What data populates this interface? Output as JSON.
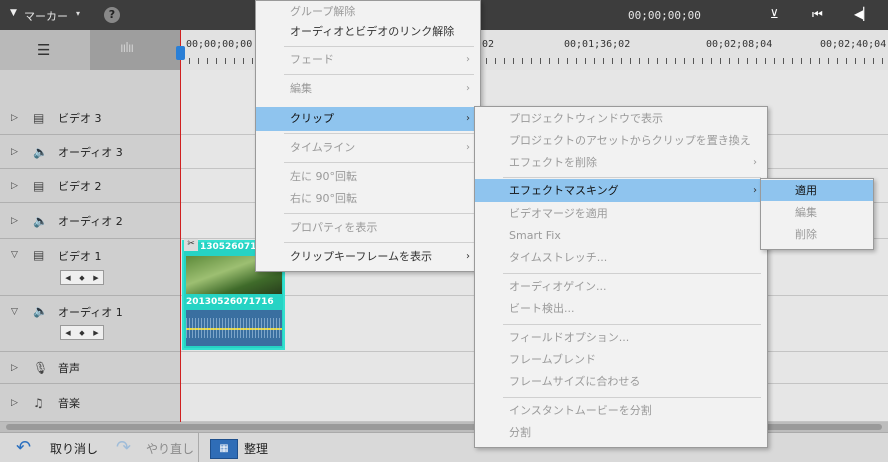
{
  "topbar": {
    "marker_label": "マーカー",
    "timecode": "00;00;00;00"
  },
  "ruler": {
    "ticks": [
      "00;00;00;00",
      "02",
      "00;01;36;02",
      "00;02;08;04",
      "00;02;40;04"
    ]
  },
  "tracks": [
    {
      "name": "ビデオ 3",
      "icon": "film-icon",
      "expanded": false
    },
    {
      "name": "オーディオ 3",
      "icon": "speaker-icon",
      "expanded": false
    },
    {
      "name": "ビデオ 2",
      "icon": "film-icon",
      "expanded": false
    },
    {
      "name": "オーディオ 2",
      "icon": "speaker-icon",
      "expanded": false
    },
    {
      "name": "ビデオ 1",
      "icon": "film-icon",
      "expanded": true
    },
    {
      "name": "オーディオ 1",
      "icon": "speaker-icon",
      "expanded": true
    },
    {
      "name": "音声",
      "icon": "mic-icon",
      "expanded": false
    },
    {
      "name": "音楽",
      "icon": "music-icon",
      "expanded": false
    }
  ],
  "clip": {
    "video_label": "130526071",
    "audio_label": "20130526071716"
  },
  "bottom": {
    "undo": "取り消し",
    "redo": "やり直し",
    "organize": "整理"
  },
  "menu1": {
    "items": [
      "グループ解除",
      "オーディオとビデオのリンク解除",
      "フェード",
      "編集",
      "クリップ",
      "タイムライン",
      "左に 90°回転",
      "右に 90°回転",
      "プロパティを表示",
      "クリップキーフレームを表示"
    ]
  },
  "menu2": {
    "items": [
      "プロジェクトウィンドウで表示",
      "プロジェクトのアセットからクリップを置き換え",
      "エフェクトを削除",
      "エフェクトマスキング",
      "ビデオマージを適用",
      "Smart Fix",
      "タイムストレッチ...",
      "オーディオゲイン...",
      "ビート検出...",
      "フィールドオプション...",
      "フレームブレンド",
      "フレームサイズに合わせる",
      "インスタントムービーを分割",
      "分割"
    ]
  },
  "menu3": {
    "items": [
      "適用",
      "編集",
      "削除"
    ]
  }
}
